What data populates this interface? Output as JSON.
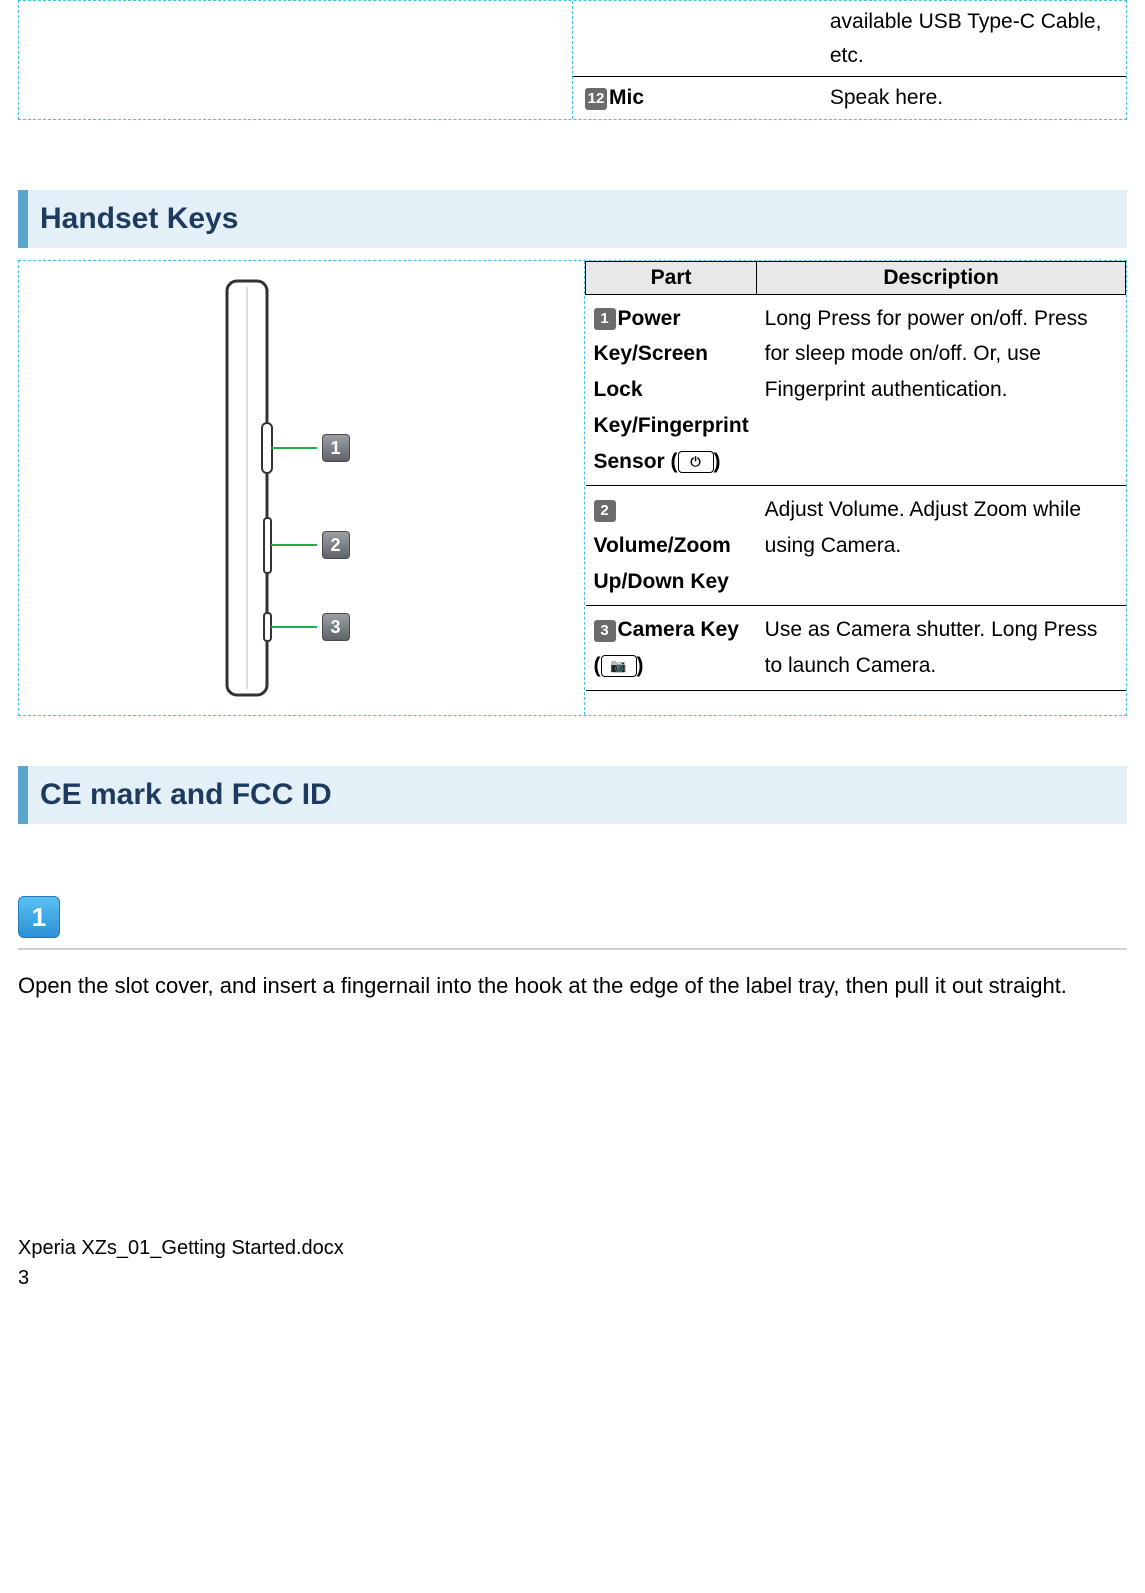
{
  "top_table": {
    "row1_desc": "available USB Type-C Cable, etc.",
    "row2_badge": "12",
    "row2_part": "Mic",
    "row2_desc": "Speak here."
  },
  "sections": {
    "handset_keys": "Handset Keys",
    "ce_fcc": "CE mark and FCC ID"
  },
  "parts_table": {
    "header_part": "Part",
    "header_desc": "Description",
    "rows": [
      {
        "badge": "1",
        "part_a": "Power Key/Screen Lock Key/Fingerprint Sensor (",
        "part_b": ")",
        "icon": "power",
        "desc": "Long Press for power on/off. Press for sleep mode on/off. Or, use Fingerprint authentication."
      },
      {
        "badge": "2",
        "part_a": "Volume/Zoom Up/Down Key",
        "part_b": "",
        "icon": "",
        "desc": "Adjust Volume. Adjust Zoom while using Camera."
      },
      {
        "badge": "3",
        "part_a": "Camera Key (",
        "part_b": ")",
        "icon": "camera",
        "desc": "Use as Camera shutter. Long Press to launch Camera."
      }
    ]
  },
  "callouts": {
    "c1": "1",
    "c2": "2",
    "c3": "3"
  },
  "step": {
    "num": "1",
    "text": "Open the slot cover, and insert a fingernail into the hook at the edge of the label tray, then pull it out straight."
  },
  "footer": {
    "filename": "Xperia XZs_01_Getting Started.docx",
    "page": "3"
  }
}
